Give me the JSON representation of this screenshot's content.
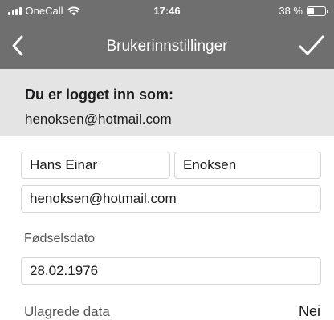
{
  "status_bar": {
    "carrier": "OneCall",
    "time": "17:46",
    "battery": "38 %",
    "battery_level": 0.38
  },
  "nav": {
    "title": "Brukerinnstillinger",
    "back_icon": "chevron-left-icon",
    "done_icon": "checkmark-icon"
  },
  "account": {
    "heading": "Du er logget inn som:",
    "email": "henoksen@hotmail.com"
  },
  "form": {
    "first_name": "Hans Einar",
    "last_name": "Enoksen",
    "email": "henoksen@hotmail.com",
    "birthdate_label": "Fødselsdato",
    "birthdate": "28.02.1976"
  },
  "unsaved": {
    "label": "Ulagrede data",
    "value": "Nei"
  }
}
